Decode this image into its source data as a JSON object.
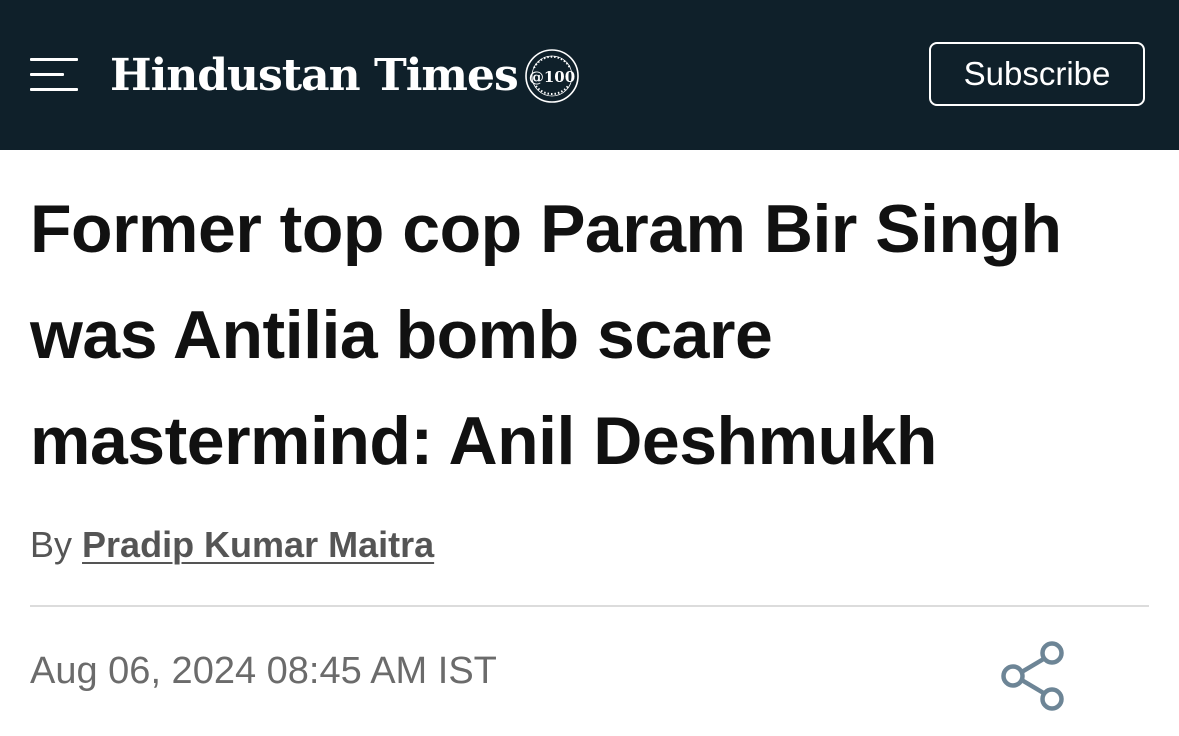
{
  "header": {
    "logo_text": "Hindustan Times",
    "badge_text": "@100",
    "subscribe_label": "Subscribe",
    "background_color": "#0f202a"
  },
  "article": {
    "headline": "Former top cop Param Bir Singh was Antilia bomb scare mastermind: Anil Deshmukh",
    "byline_prefix": "By",
    "author": "Pradip Kumar Maitra",
    "timestamp": "Aug 06, 2024 08:45 AM IST"
  },
  "icons": {
    "menu": "hamburger-menu-icon",
    "share": "share-icon",
    "share_color": "#6d8596"
  }
}
